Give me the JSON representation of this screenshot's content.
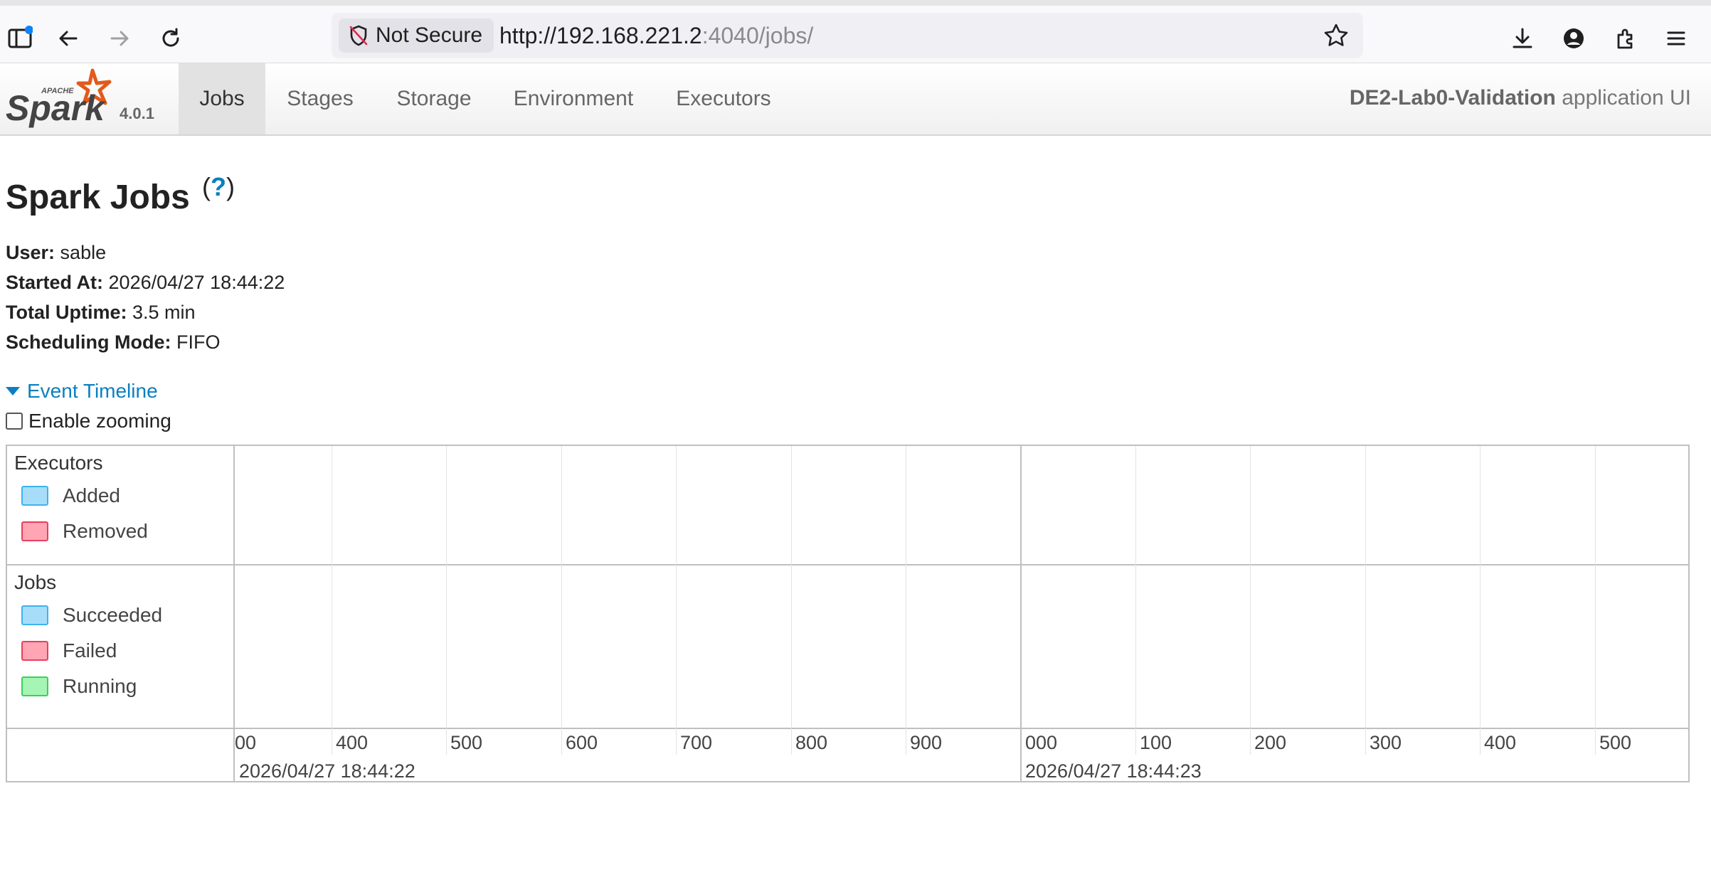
{
  "browser": {
    "not_secure_label": "Not Secure",
    "url_host": "http://192.168.221.2",
    "url_rest": ":4040/jobs/"
  },
  "spark": {
    "version": "4.0.1",
    "tabs": [
      {
        "label": "Jobs",
        "active": true
      },
      {
        "label": "Stages",
        "active": false
      },
      {
        "label": "Storage",
        "active": false
      },
      {
        "label": "Environment",
        "active": false
      },
      {
        "label": "Executors",
        "active": false
      }
    ],
    "app_name": "DE2-Lab0-Validation",
    "app_suffix": " application UI"
  },
  "page": {
    "title": "Spark Jobs",
    "help": "?",
    "user_label": "User:",
    "user_value": "sable",
    "started_label": "Started At:",
    "started_value": "2026/04/27 18:44:22",
    "uptime_label": "Total Uptime:",
    "uptime_value": "3.5 min",
    "scheduling_label": "Scheduling Mode:",
    "scheduling_value": "FIFO",
    "timeline_toggle": "Event Timeline",
    "zoom_label": "Enable zooming"
  },
  "timeline": {
    "executors_group": "Executors",
    "executors_legend": [
      {
        "label": "Added",
        "fill": "#a8ddf9",
        "border": "#3eb3ee"
      },
      {
        "label": "Removed",
        "fill": "#ffa5b4",
        "border": "#e6405c"
      }
    ],
    "jobs_group": "Jobs",
    "jobs_legend": [
      {
        "label": "Succeeded",
        "fill": "#a8ddf9",
        "border": "#3eb3ee"
      },
      {
        "label": "Failed",
        "fill": "#ffa5b4",
        "border": "#e6405c"
      },
      {
        "label": "Running",
        "fill": "#a5f5b4",
        "border": "#3ece5a"
      }
    ],
    "minor_ticks": [
      "00",
      "400",
      "500",
      "600",
      "700",
      "800",
      "900",
      "000",
      "100",
      "200",
      "300",
      "400",
      "500"
    ],
    "major_ticks": [
      "2026/04/27 18:44:22",
      "2026/04/27 18:44:23"
    ]
  }
}
